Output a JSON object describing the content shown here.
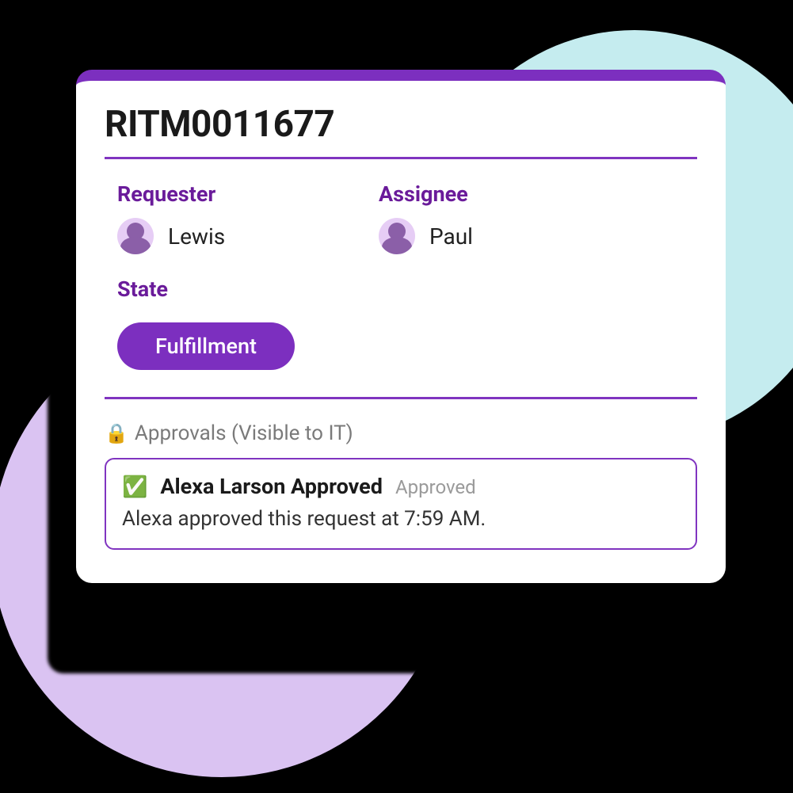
{
  "ticket": {
    "id": "RITM0011677",
    "fields": {
      "requester": {
        "label": "Requester",
        "name": "Lewis"
      },
      "assignee": {
        "label": "Assignee",
        "name": "Paul"
      },
      "state": {
        "label": "State",
        "value": "Fulfillment"
      }
    }
  },
  "approvals": {
    "section_label": "Approvals (Visible to IT)",
    "lock_icon": "🔒",
    "items": [
      {
        "check_icon": "✅",
        "title": "Alexa Larson Approved",
        "status": "Approved",
        "body": "Alexa approved this request at 7:59 AM."
      }
    ]
  }
}
